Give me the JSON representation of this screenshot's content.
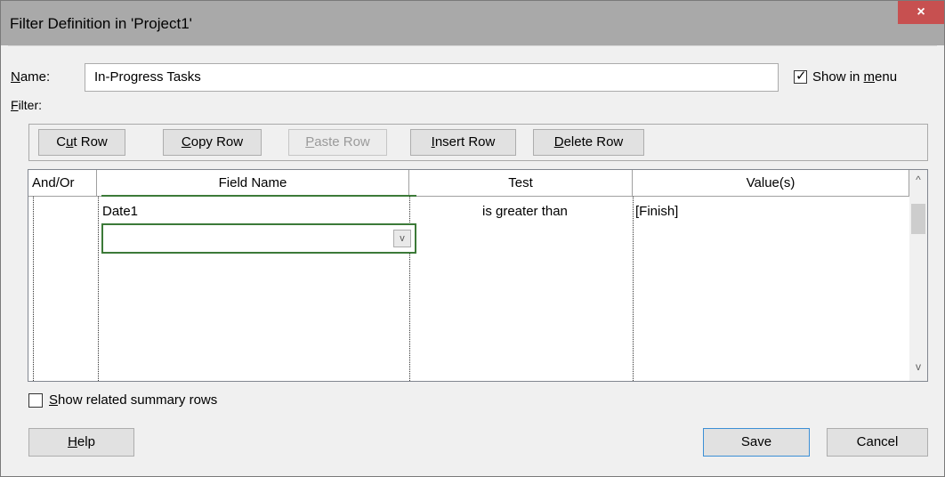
{
  "window": {
    "title": "Filter Definition in 'Project1'",
    "close_glyph": "×"
  },
  "name_row": {
    "label_first": "N",
    "label_rest": "ame:",
    "value": "In-Progress Tasks",
    "show_in_menu_pre": "Show in ",
    "show_in_menu_ul": "m",
    "show_in_menu_post": "enu",
    "show_in_menu_checked": true
  },
  "filter_label_first": "F",
  "filter_label_rest": "ilter:",
  "toolbar": {
    "cut_pre": "C",
    "cut_ul": "u",
    "cut_post": "t Row",
    "copy_ul": "C",
    "copy_post": "opy Row",
    "paste_ul": "P",
    "paste_post": "aste Row",
    "insert_ul": "I",
    "insert_post": "nsert Row",
    "delete_ul": "D",
    "delete_post": "elete Row"
  },
  "grid": {
    "headers": [
      "And/Or",
      "Field Name",
      "Test",
      "Value(s)"
    ],
    "rows": [
      {
        "and_or": "",
        "field_name": "Date1",
        "test": "is greater than",
        "values": "[Finish]"
      }
    ],
    "editor_value": ""
  },
  "show_related": {
    "ul": "S",
    "rest": "how related summary rows",
    "checked": false
  },
  "footer": {
    "help_ul": "H",
    "help_rest": "elp",
    "save": "Save",
    "cancel": "Cancel"
  },
  "icons": {
    "checkmark": "✓",
    "dropdown": "v",
    "scroll_up": "^",
    "scroll_down": "v"
  }
}
